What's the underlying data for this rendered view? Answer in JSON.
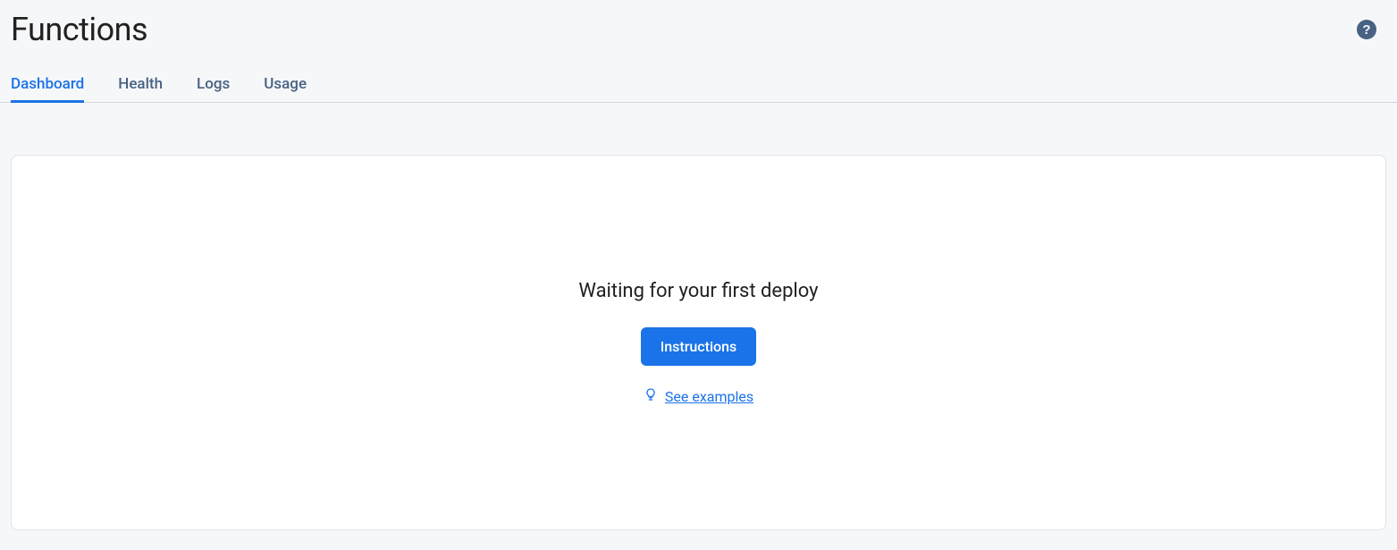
{
  "header": {
    "title": "Functions"
  },
  "tabs": {
    "items": [
      {
        "label": "Dashboard",
        "active": true
      },
      {
        "label": "Health",
        "active": false
      },
      {
        "label": "Logs",
        "active": false
      },
      {
        "label": "Usage",
        "active": false
      }
    ]
  },
  "emptyState": {
    "heading": "Waiting for your first deploy",
    "instructionsButton": "Instructions",
    "examplesLink": "See examples"
  }
}
